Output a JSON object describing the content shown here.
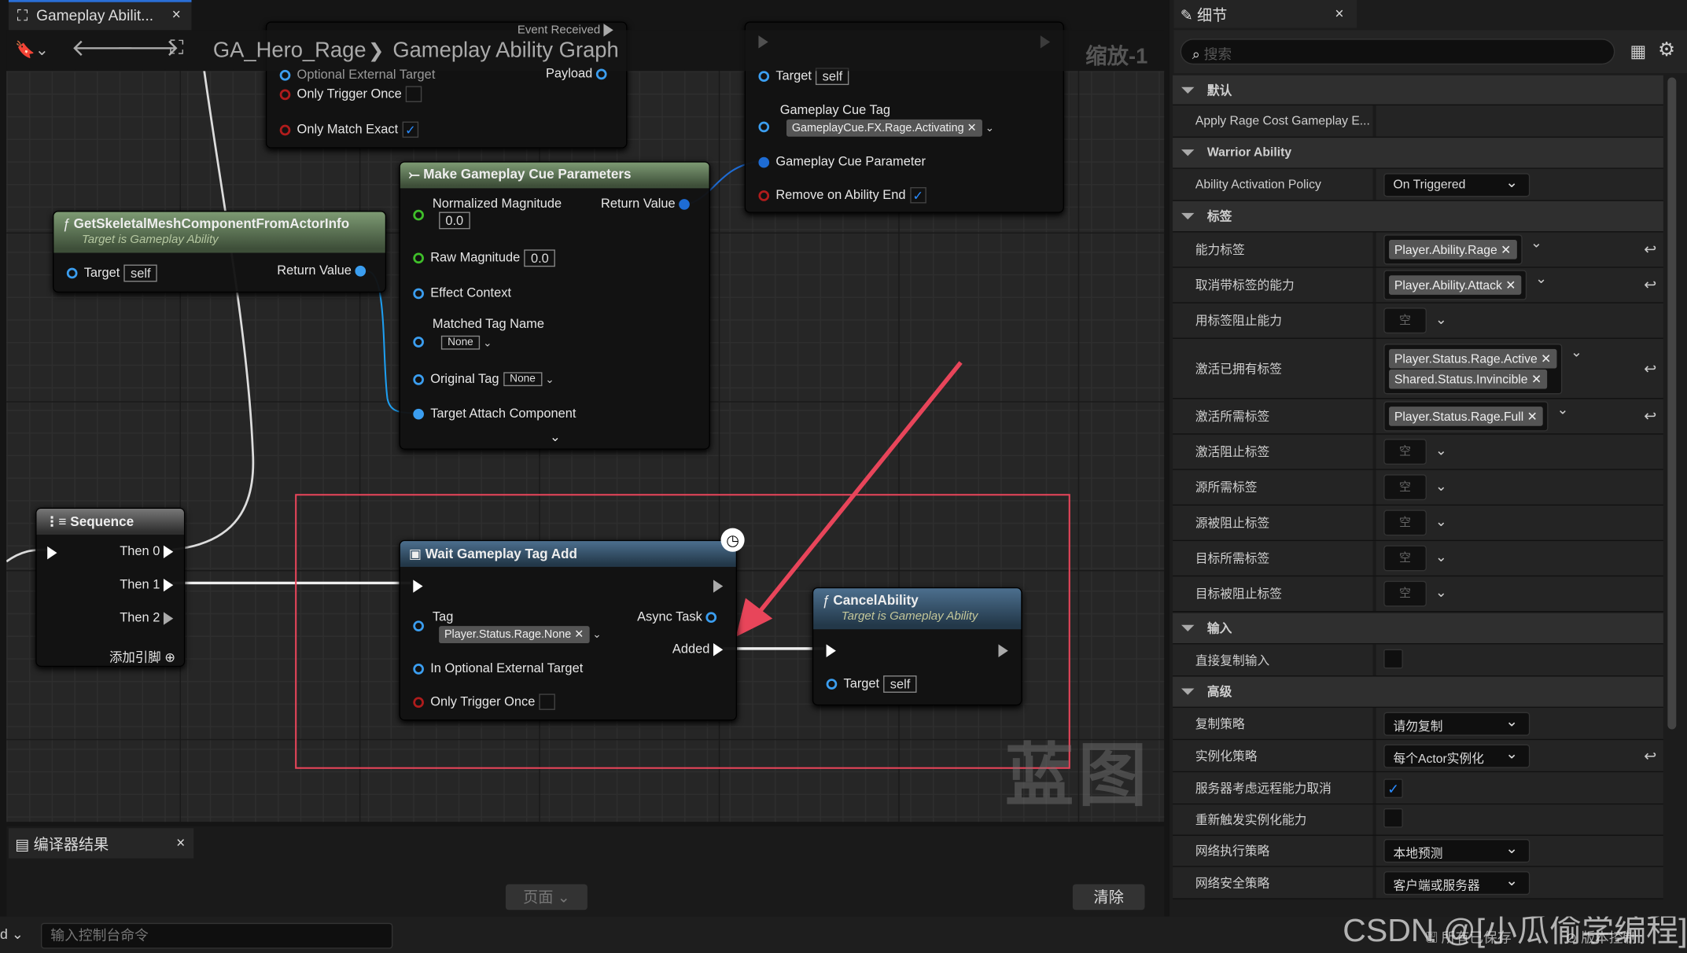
{
  "tab": {
    "title": "Gameplay Abilit...",
    "close": "×"
  },
  "toolbar": {
    "breadcrumb_asset": "GA_Hero_Rage",
    "breadcrumb_sep": "❯",
    "breadcrumb_graph": "Gameplay Ability Graph",
    "zoom": "缩放-1"
  },
  "nodes": {
    "wait_top": {
      "optional_target": "Optional External Target",
      "event_received": "Event Received",
      "payload": "Payload",
      "only_trigger_once": "Only Trigger Once",
      "only_trigger_once_checked": false,
      "only_match_exact": "Only Match Exact",
      "only_match_exact_checked": true
    },
    "cue": {
      "target": "Target",
      "target_value": "self",
      "cue_tag": "Gameplay Cue Tag",
      "cue_tag_value": "GameplayCue.FX.Rage.Activating",
      "cue_param": "Gameplay Cue Parameter",
      "remove_on_end": "Remove on Ability End",
      "remove_on_end_checked": true
    },
    "make_params": {
      "title": "Make Gameplay Cue Parameters",
      "normalized": "Normalized Magnitude",
      "normalized_value": "0.0",
      "return_value": "Return Value",
      "raw": "Raw Magnitude",
      "raw_value": "0.0",
      "effect_context": "Effect Context",
      "matched_tag_name": "Matched Tag Name",
      "matched_value": "None",
      "original_tag": "Original Tag",
      "original_value": "None",
      "target_attach": "Target Attach Component"
    },
    "get_mesh": {
      "title": "GetSkeletalMeshComponentFromActorInfo",
      "subtitle": "Target is Gameplay Ability",
      "target": "Target",
      "target_value": "self",
      "return_value": "Return Value"
    },
    "sequence": {
      "title": "Sequence",
      "then0": "Then 0",
      "then1": "Then 1",
      "then2": "Then 2",
      "add_pin": "添加引脚"
    },
    "wait_tag_add": {
      "title": "Wait Gameplay Tag Add",
      "tag": "Tag",
      "tag_value": "Player.Status.Rage.None",
      "async_task": "Async Task",
      "added": "Added",
      "optional_target": "In Optional External Target",
      "only_trigger_once": "Only Trigger Once",
      "only_trigger_once_checked": false
    },
    "cancel": {
      "title": "CancelAbility",
      "subtitle": "Target is Gameplay Ability",
      "target": "Target",
      "target_value": "self"
    }
  },
  "watermark_graph": "蓝图",
  "annotation_color": "#e8455a",
  "bottom": {
    "compiler_tab": "编译器结果",
    "close": "×",
    "page_button": "页面",
    "clear_button": "清除",
    "console_placeholder": "输入控制台命令",
    "all_saved": "所有已保存",
    "source_control": "版本控制",
    "csdn_watermark": "CSDN @[小瓜偷学编程]"
  },
  "details": {
    "tab": "细节",
    "close": "×",
    "search_placeholder": "搜索",
    "cat_default": "默认",
    "apply_rage": "Apply Rage Cost Gameplay E...",
    "cat_warrior": "Warrior Ability",
    "activation_policy": "Ability Activation Policy",
    "activation_policy_value": "On Triggered",
    "cat_tags": "标签",
    "tag_rows": [
      {
        "label": "能力标签",
        "tags": [
          "Player.Ability.Rage"
        ],
        "reset": true
      },
      {
        "label": "取消带标签的能力",
        "tags": [
          "Player.Ability.Attack"
        ],
        "reset": true
      },
      {
        "label": "用标签阻止能力",
        "tags": [],
        "reset": false
      },
      {
        "label": "激活已拥有标签",
        "tags": [
          "Player.Status.Rage.Active",
          "Shared.Status.Invincible"
        ],
        "reset": true
      },
      {
        "label": "激活所需标签",
        "tags": [
          "Player.Status.Rage.Full"
        ],
        "reset": true
      },
      {
        "label": "激活阻止标签",
        "tags": [],
        "reset": false
      },
      {
        "label": "源所需标签",
        "tags": [],
        "reset": false
      },
      {
        "label": "源被阻止标签",
        "tags": [],
        "reset": false
      },
      {
        "label": "目标所需标签",
        "tags": [],
        "reset": false
      },
      {
        "label": "目标被阻止标签",
        "tags": [],
        "reset": false
      }
    ],
    "empty": "空",
    "cat_input": "输入",
    "direct_replicate": "直接复制输入",
    "direct_replicate_checked": false,
    "cat_advanced": "高级",
    "replication_policy": "复制策略",
    "replication_policy_value": "请勿复制",
    "instancing_policy": "实例化策略",
    "instancing_policy_value": "每个Actor实例化",
    "server_respects_cancel": "服务器考虑远程能力取消",
    "server_respects_cancel_checked": true,
    "retrigger": "重新触发实例化能力",
    "retrigger_checked": false,
    "net_exec": "网络执行策略",
    "net_exec_value": "本地预测",
    "net_security": "网络安全策略",
    "net_security_value": "客户端或服务器"
  }
}
